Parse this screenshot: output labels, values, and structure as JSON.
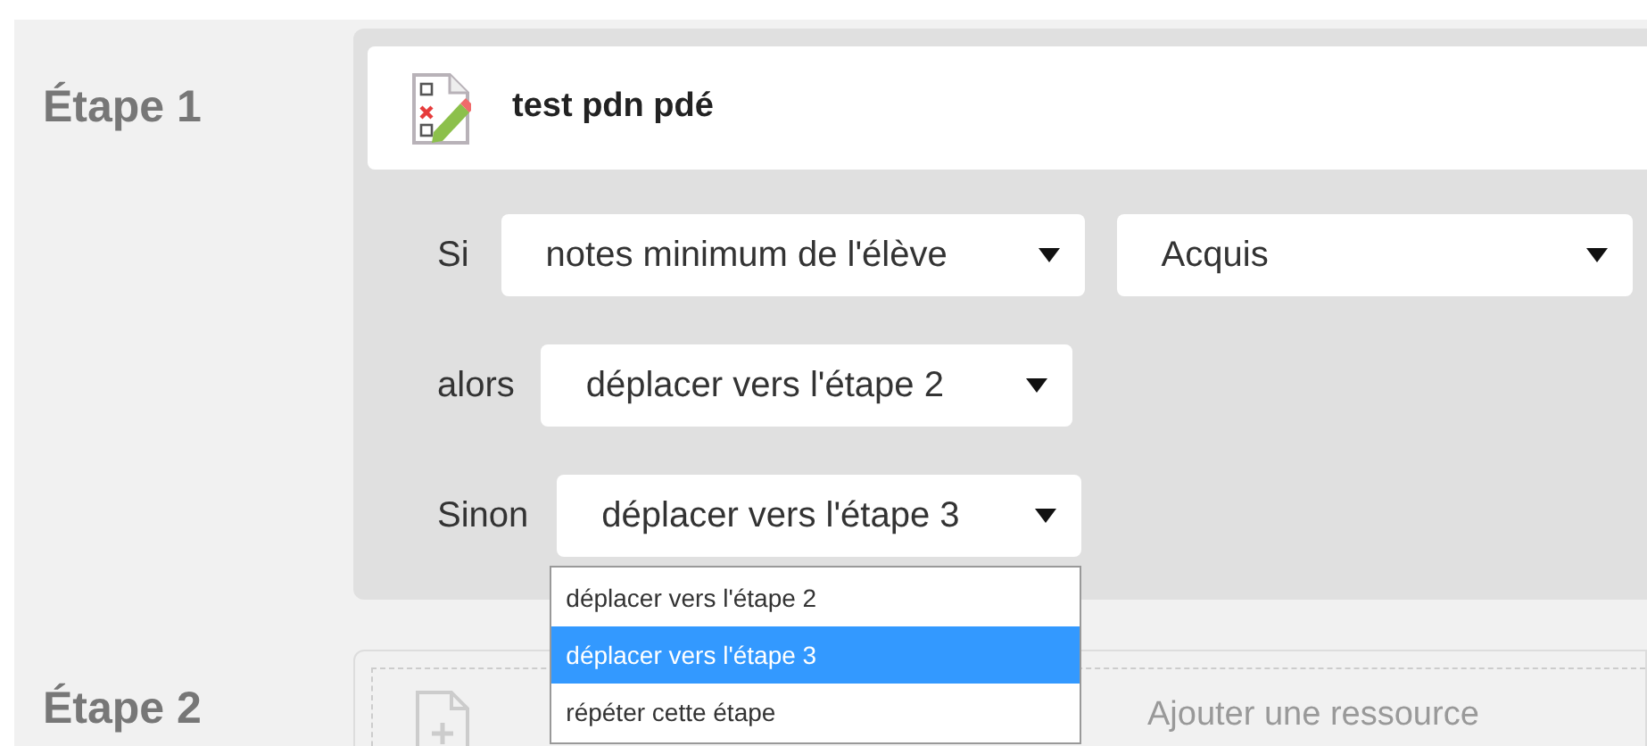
{
  "steps": [
    {
      "label": "Étape 1",
      "resource": {
        "title": "test pdn pdé"
      },
      "rules": [
        {
          "label": "Si",
          "selects": [
            {
              "value": "notes minimum de l'élève"
            },
            {
              "value": "Acquis"
            }
          ]
        },
        {
          "label": "alors",
          "selects": [
            {
              "value": "déplacer vers l'étape 2"
            }
          ]
        },
        {
          "label": "Sinon",
          "selects": [
            {
              "value": "déplacer vers l'étape 3",
              "expanded": true,
              "options": [
                {
                  "label": "déplacer vers l'étape 2",
                  "selected": false
                },
                {
                  "label": "déplacer vers l'étape 3",
                  "selected": true
                },
                {
                  "label": "répéter cette étape",
                  "selected": false
                }
              ]
            }
          ]
        }
      ]
    },
    {
      "label": "Étape 2",
      "add_resource": "Ajouter une ressource"
    }
  ]
}
